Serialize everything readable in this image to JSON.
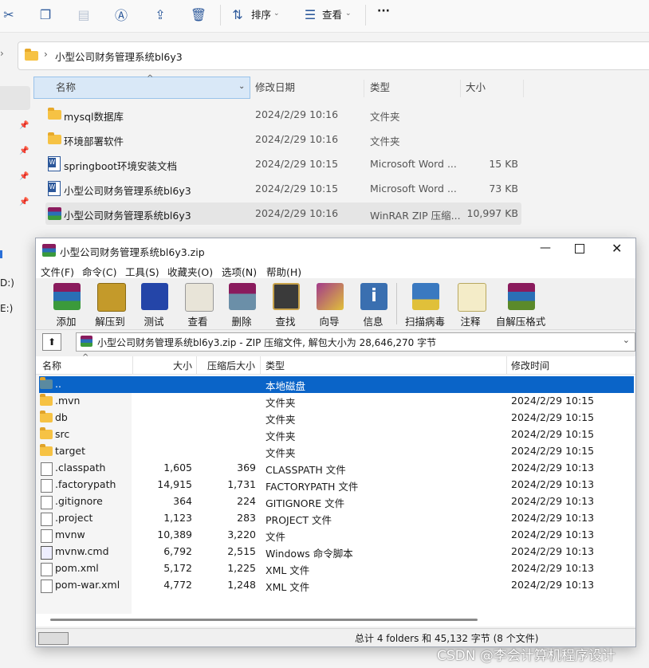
{
  "explorer": {
    "toolbar": {
      "sort_label": "排序",
      "view_label": "查看",
      "more_label": "···"
    },
    "breadcrumb": {
      "separator": "›",
      "folder": "小型公司财务管理系统bl6y3"
    },
    "columns": {
      "name": "名称",
      "modified": "修改日期",
      "type": "类型",
      "size": "大小"
    },
    "files": [
      {
        "name": "mysql数据库",
        "modified": "2024/2/29 10:16",
        "type": "文件夹",
        "size": "",
        "icon": "folder-icon"
      },
      {
        "name": "环境部署软件",
        "modified": "2024/2/29 10:16",
        "type": "文件夹",
        "size": "",
        "icon": "folder-icon"
      },
      {
        "name": "springboot环境安装文档",
        "modified": "2024/2/29 10:15",
        "type": "Microsoft Word ...",
        "size": "15 KB",
        "icon": "word-doc-icon"
      },
      {
        "name": "小型公司财务管理系统bl6y3",
        "modified": "2024/2/29 10:15",
        "type": "Microsoft Word ...",
        "size": "73 KB",
        "icon": "word-doc-icon"
      },
      {
        "name": "小型公司财务管理系统bl6y3",
        "modified": "2024/2/29 10:16",
        "type": "WinRAR ZIP 压缩...",
        "size": "10,997 KB",
        "icon": "winrar-archive-icon"
      }
    ],
    "sidebar_drive_labels": [
      "D:)",
      "E:)"
    ]
  },
  "winrar": {
    "title": "小型公司财务管理系统bl6y3.zip",
    "menu": [
      "文件(F)",
      "命令(C)",
      "工具(S)",
      "收藏夹(O)",
      "选项(N)",
      "帮助(H)"
    ],
    "toolbar": [
      {
        "label": "添加",
        "icon": "add-archive-icon",
        "color": "#8a1b5d"
      },
      {
        "label": "解压到",
        "icon": "extract-to-icon",
        "color": "#c49a2a"
      },
      {
        "label": "测试",
        "icon": "test-icon",
        "color": "#2445a8"
      },
      {
        "label": "查看",
        "icon": "view-icon",
        "color": "#d8d2c0"
      },
      {
        "label": "删除",
        "icon": "delete-icon",
        "color": "#6b8fa8"
      },
      {
        "label": "查找",
        "icon": "find-icon",
        "color": "#c8a24a"
      },
      {
        "label": "向导",
        "icon": "wizard-icon",
        "color": "#a33a8a"
      },
      {
        "label": "信息",
        "icon": "info-icon",
        "color": "#3a6fb0"
      },
      {
        "label": "扫描病毒",
        "icon": "scan-virus-icon",
        "color": "#3a79c0"
      },
      {
        "label": "注释",
        "icon": "comment-icon",
        "color": "#e8d48a"
      },
      {
        "label": "自解压格式",
        "icon": "sfx-icon",
        "color": "#5b8a2a"
      }
    ],
    "path_text": "小型公司财务管理系统bl6y3.zip - ZIP 压缩文件, 解包大小为 28,646,270 字节",
    "columns": {
      "name": "名称",
      "size": "大小",
      "packed": "压缩后大小",
      "type": "类型",
      "modified": "修改时间"
    },
    "rows": [
      {
        "name": "..",
        "size": "",
        "packed": "",
        "type": "本地磁盘",
        "modified": "",
        "kind": "up",
        "selected": true
      },
      {
        "name": ".mvn",
        "size": "",
        "packed": "",
        "type": "文件夹",
        "modified": "2024/2/29 10:15",
        "kind": "folder"
      },
      {
        "name": "db",
        "size": "",
        "packed": "",
        "type": "文件夹",
        "modified": "2024/2/29 10:15",
        "kind": "folder"
      },
      {
        "name": "src",
        "size": "",
        "packed": "",
        "type": "文件夹",
        "modified": "2024/2/29 10:15",
        "kind": "folder"
      },
      {
        "name": "target",
        "size": "",
        "packed": "",
        "type": "文件夹",
        "modified": "2024/2/29 10:15",
        "kind": "folder"
      },
      {
        "name": ".classpath",
        "size": "1,605",
        "packed": "369",
        "type": "CLASSPATH 文件",
        "modified": "2024/2/29 10:13",
        "kind": "file"
      },
      {
        "name": ".factorypath",
        "size": "14,915",
        "packed": "1,731",
        "type": "FACTORYPATH 文件",
        "modified": "2024/2/29 10:13",
        "kind": "file"
      },
      {
        "name": ".gitignore",
        "size": "364",
        "packed": "224",
        "type": "GITIGNORE 文件",
        "modified": "2024/2/29 10:13",
        "kind": "file"
      },
      {
        "name": ".project",
        "size": "1,123",
        "packed": "283",
        "type": "PROJECT 文件",
        "modified": "2024/2/29 10:13",
        "kind": "file"
      },
      {
        "name": "mvnw",
        "size": "10,389",
        "packed": "3,220",
        "type": "文件",
        "modified": "2024/2/29 10:13",
        "kind": "file"
      },
      {
        "name": "mvnw.cmd",
        "size": "6,792",
        "packed": "2,515",
        "type": "Windows 命令脚本",
        "modified": "2024/2/29 10:13",
        "kind": "script"
      },
      {
        "name": "pom.xml",
        "size": "5,172",
        "packed": "1,225",
        "type": "XML 文件",
        "modified": "2024/2/29 10:13",
        "kind": "file"
      },
      {
        "name": "pom-war.xml",
        "size": "4,772",
        "packed": "1,248",
        "type": "XML 文件",
        "modified": "2024/2/29 10:13",
        "kind": "file"
      }
    ],
    "status": "总计 4 folders 和 45,132 字节 (8 个文件)",
    "selection_color": "#0a64c8"
  },
  "watermark": "CSDN @李会计算机程序设计"
}
